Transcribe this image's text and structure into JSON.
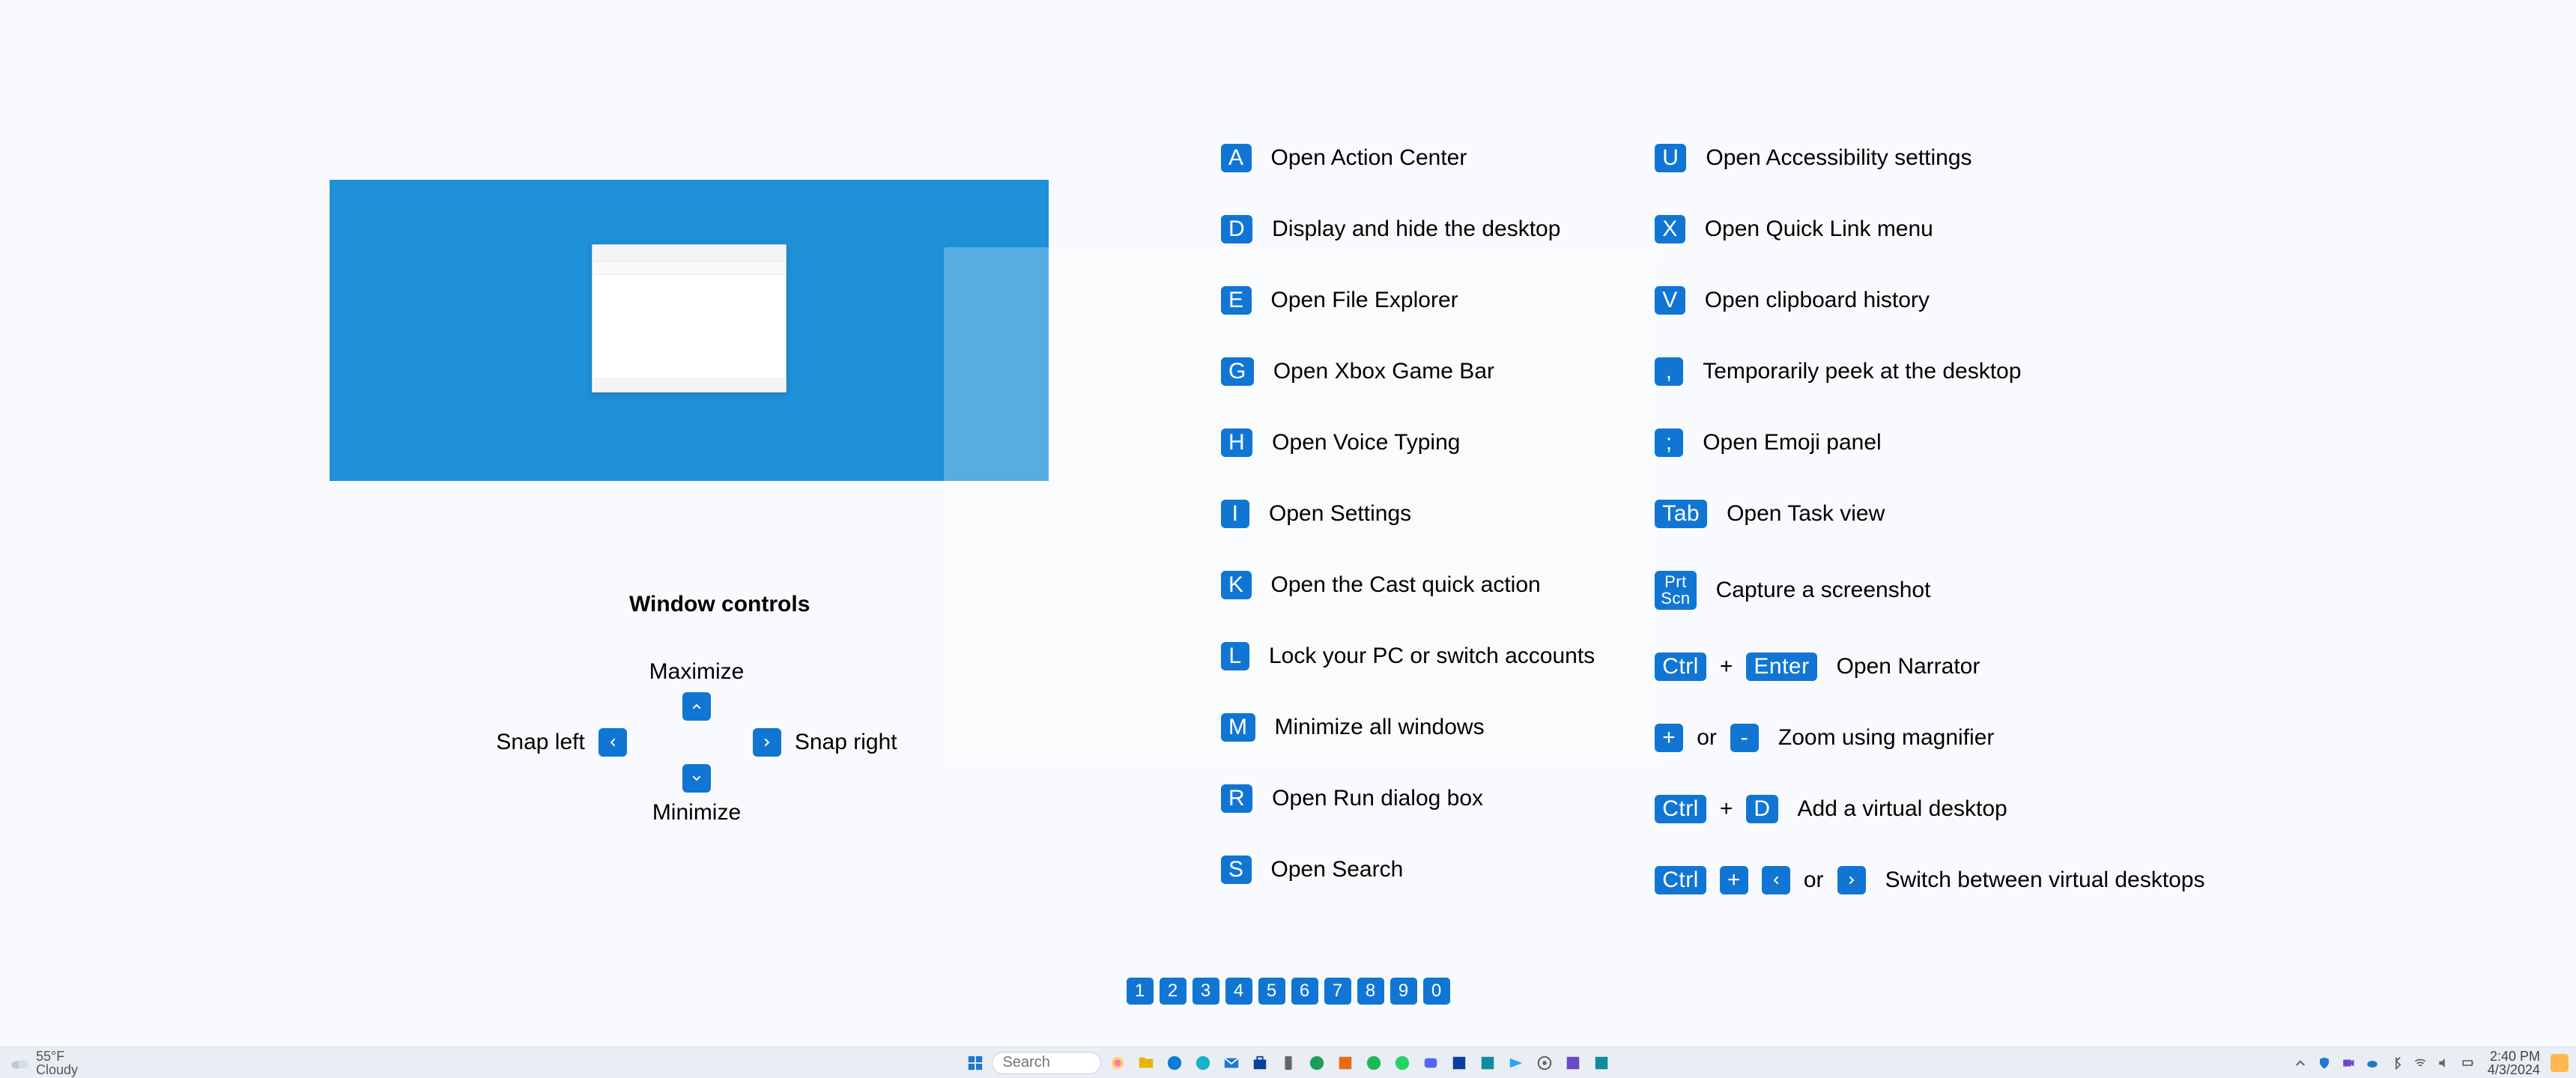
{
  "controls_title": "Window controls",
  "controls": {
    "maximize": "Maximize",
    "minimize": "Minimize",
    "snap_left": "Snap left",
    "snap_right": "Snap right"
  },
  "col1": [
    {
      "keys": [
        "A"
      ],
      "desc": "Open Action Center"
    },
    {
      "keys": [
        "D"
      ],
      "desc": "Display and hide the desktop"
    },
    {
      "keys": [
        "E"
      ],
      "desc": "Open File Explorer"
    },
    {
      "keys": [
        "G"
      ],
      "desc": "Open Xbox Game Bar"
    },
    {
      "keys": [
        "H"
      ],
      "desc": "Open Voice Typing"
    },
    {
      "keys": [
        "I"
      ],
      "desc": "Open Settings"
    },
    {
      "keys": [
        "K"
      ],
      "desc": "Open the Cast quick action"
    },
    {
      "keys": [
        "L"
      ],
      "desc": "Lock your PC or switch accounts"
    },
    {
      "keys": [
        "M"
      ],
      "desc": "Minimize all windows"
    },
    {
      "keys": [
        "R"
      ],
      "desc": "Open Run dialog box"
    },
    {
      "keys": [
        "S"
      ],
      "desc": "Open Search"
    }
  ],
  "col2": [
    {
      "keys": [
        "U"
      ],
      "desc": "Open Accessibility settings"
    },
    {
      "keys": [
        "X"
      ],
      "desc": "Open Quick Link menu"
    },
    {
      "keys": [
        "V"
      ],
      "desc": "Open clipboard history"
    },
    {
      "keys": [
        ","
      ],
      "desc": "Temporarily peek at the desktop"
    },
    {
      "keys": [
        ";"
      ],
      "desc": "Open Emoji panel"
    },
    {
      "keys": [
        "Tab"
      ],
      "wide": true,
      "desc": "Open Task view"
    },
    {
      "keys": [
        "Prt\nScn"
      ],
      "multi": true,
      "desc": "Capture a screenshot"
    },
    {
      "keys": [
        "Ctrl",
        "+",
        "Enter"
      ],
      "wides": [
        true,
        false,
        true
      ],
      "desc": "Open Narrator"
    },
    {
      "keys": [
        "+",
        "or",
        "-"
      ],
      "desc": "Zoom using magnifier"
    },
    {
      "keys": [
        "Ctrl",
        "+",
        "D"
      ],
      "wides": [
        true,
        false,
        false
      ],
      "desc": "Add a virtual desktop"
    },
    {
      "keys": [
        "Ctrl",
        "+",
        "arrow-left",
        "or",
        "arrow-right"
      ],
      "wides": [
        true,
        false,
        false,
        false,
        false
      ],
      "desc": "Switch between virtual desktops"
    }
  ],
  "pager": [
    "1",
    "2",
    "3",
    "4",
    "5",
    "6",
    "7",
    "8",
    "9",
    "0"
  ],
  "weather": {
    "temp": "55°F",
    "cond": "Cloudy"
  },
  "search_placeholder": "Search",
  "taskbar_icons": [
    "start",
    "search",
    "copilot",
    "file-explorer",
    "edge-1",
    "edge-2",
    "mail",
    "store",
    "phone",
    "xbox",
    "media",
    "spotify",
    "whatsapp",
    "discord",
    "todo",
    "code",
    "vscode",
    "settings",
    "app1",
    "app2"
  ],
  "tray_icons": [
    "chevron-up",
    "defender",
    "meet",
    "onedrive",
    "bluetooth",
    "wifi",
    "volume",
    "battery"
  ],
  "clock": {
    "time": "2:40 PM",
    "date": "4/3/2024"
  }
}
